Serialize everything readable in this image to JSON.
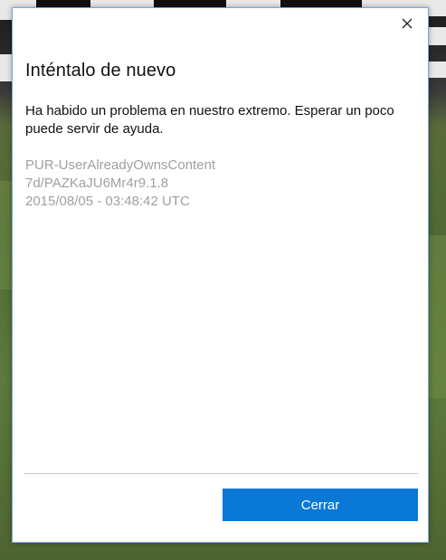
{
  "dialog": {
    "title": "Inténtalo de nuevo",
    "message": "Ha habido un problema en nuestro extremo. Esperar un poco puede servir de ayuda.",
    "details": [
      "PUR-UserAlreadyOwnsContent",
      "7d/PAZKaJU6Mr4r9.1.8",
      "2015/08/05 - 03:48:42 UTC"
    ],
    "close_icon": "close-icon",
    "primary_button_label": "Cerrar",
    "accent_color": "#0a78d7"
  }
}
